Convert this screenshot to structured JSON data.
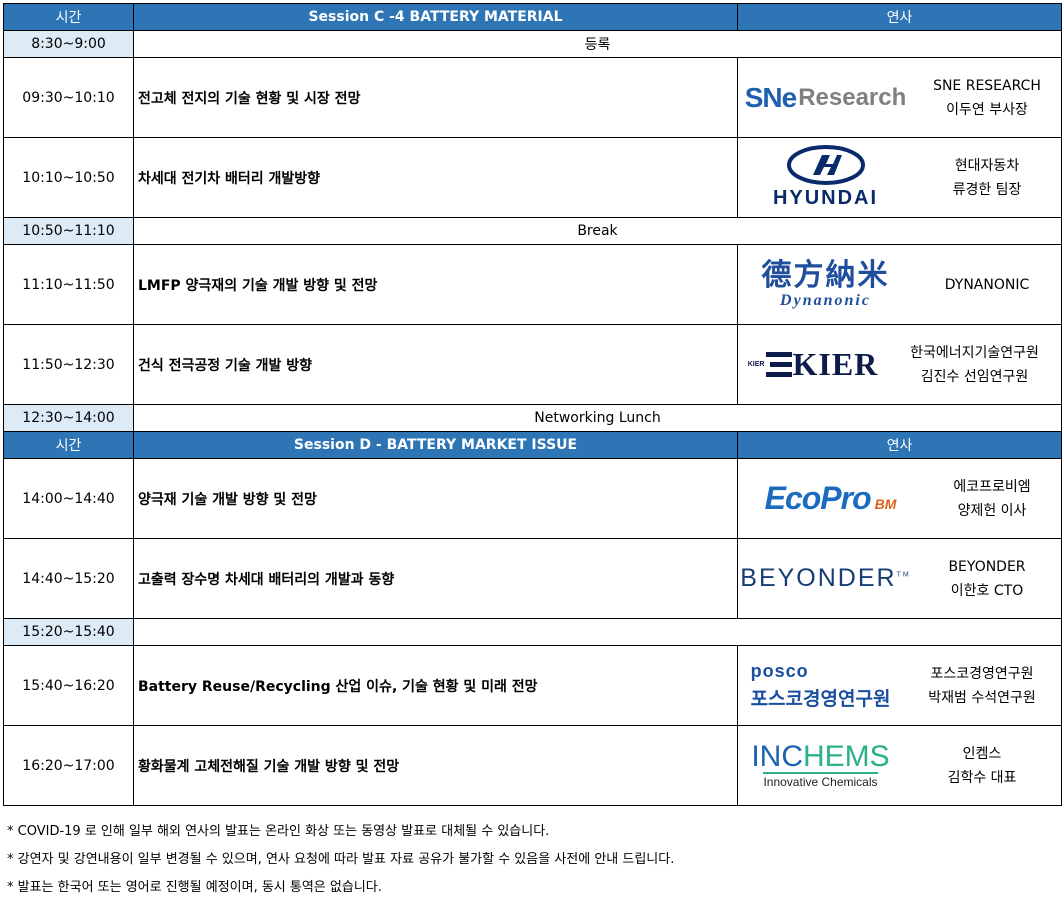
{
  "session_c": {
    "header": {
      "time": "시간",
      "title": "Session C -4 BATTERY MATERIAL",
      "speaker": "연사"
    },
    "rows": [
      {
        "kind": "thin",
        "time": "8:30~9:00",
        "label": "등록"
      },
      {
        "kind": "talk",
        "time": "09:30~10:10",
        "title": "전고체 전지의 기술 현황 및 시장 전망",
        "logo": "sne-research-logo",
        "logo_text": [
          "SNe",
          "Research"
        ],
        "speaker": [
          "SNE RESEARCH",
          "이두연 부사장"
        ]
      },
      {
        "kind": "talk",
        "time": "10:10~10:50",
        "title": "차세대 전기차 배터리 개발방향",
        "logo": "hyundai-logo",
        "logo_text": [
          "HYUNDAI"
        ],
        "speaker": [
          "현대자동차",
          "류경한 팀장"
        ]
      },
      {
        "kind": "thin",
        "time": "10:50~11:10",
        "label": "Break"
      },
      {
        "kind": "talk",
        "time": "11:10~11:50",
        "title": "LMFP 양극재의 기술 개발 방향 및 전망",
        "logo": "dynanonic-logo",
        "logo_text": [
          "德方納米",
          "Dynanonic"
        ],
        "speaker": [
          "DYNANONIC"
        ]
      },
      {
        "kind": "talk",
        "time": "11:50~12:30",
        "title": "건식 전극공정 기술 개발 방향",
        "logo": "kier-logo",
        "logo_text": [
          "KIER",
          "KIER"
        ],
        "speaker": [
          "한국에너지기술연구원",
          "김진수 선임연구원"
        ]
      },
      {
        "kind": "thin",
        "time": "12:30~14:00",
        "label": "Networking Lunch"
      }
    ]
  },
  "session_d": {
    "header": {
      "time": "시간",
      "title": "Session D - BATTERY MARKET ISSUE",
      "speaker": "연사"
    },
    "rows": [
      {
        "kind": "talk",
        "time": "14:00~14:40",
        "title": "양극재 기술 개발 방향 및 전망",
        "logo": "ecopro-bm-logo",
        "logo_text": [
          "EcoPro",
          "BM"
        ],
        "speaker": [
          "에코프로비엠",
          "양제헌 이사"
        ]
      },
      {
        "kind": "talk",
        "time": "14:40~15:20",
        "title": "고출력 장수명 차세대 배터리의 개발과 동향",
        "logo": "beyonder-logo",
        "logo_text": [
          "BEYONDER"
        ],
        "speaker": [
          "BEYONDER",
          "이한호 CTO"
        ]
      },
      {
        "kind": "thin",
        "time": "15:20~15:40",
        "label": ""
      },
      {
        "kind": "talk",
        "time": "15:40~16:20",
        "title": "Battery Reuse/Recycling 산업 이슈, 기술 현황 및 미래 전망",
        "logo": "posco-logo",
        "logo_text": [
          "posco",
          "포스코경영연구원"
        ],
        "speaker": [
          "포스코경영연구원",
          "박재범 수석연구원"
        ]
      },
      {
        "kind": "talk",
        "time": "16:20~17:00",
        "title": "황화물계 고체전해질 기술 개발 방향 및 전망",
        "logo": "inchems-logo",
        "logo_text": [
          "INC",
          "HEMS",
          "Innovative Chemicals"
        ],
        "speaker": [
          "인켐스",
          "김학수 대표"
        ]
      }
    ]
  },
  "notes": [
    "* COVID-19 로 인해 일부 해외 연사의 발표는 온라인 화상 또는 동영상 발표로 대체될 수 있습니다.",
    "* 강연자 및 강연내용이 일부 변경될 수 있으며, 연사 요청에 따라 발표 자료 공유가 불가할 수 있음을 사전에 안내 드립니다.",
    "* 발표는 한국어 또는 영어로 진행될 예정이며, 동시 통역은 없습니다."
  ],
  "colors": {
    "header_bg": "#2e75b6",
    "time_bg": "#ddebf7"
  }
}
